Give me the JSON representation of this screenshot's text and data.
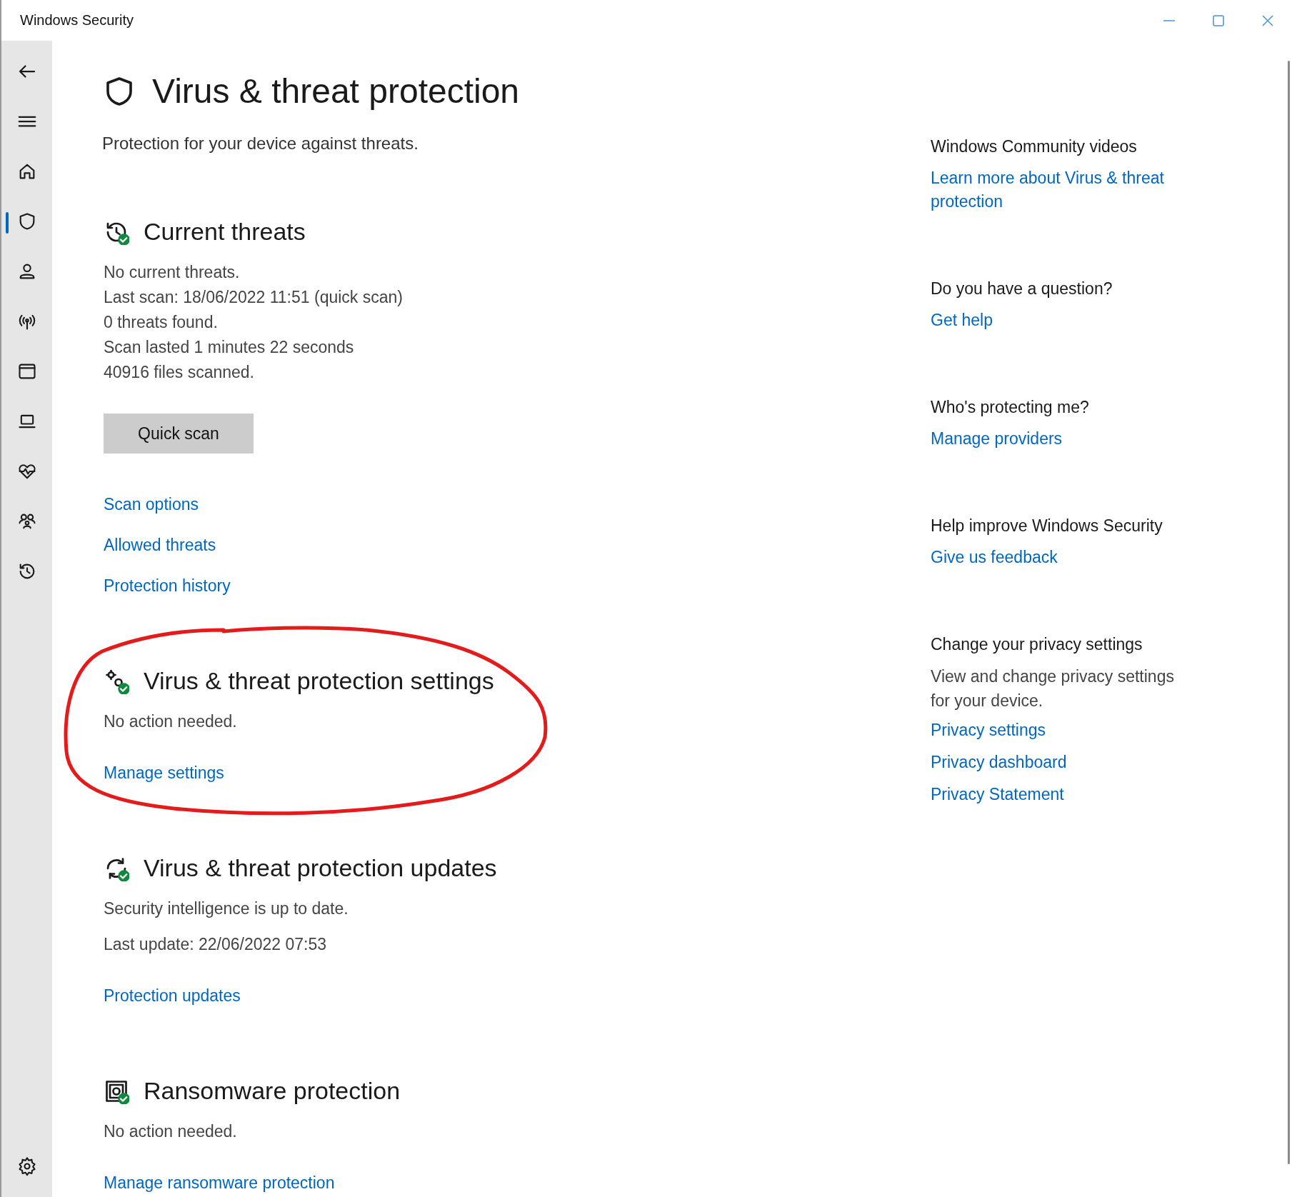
{
  "window": {
    "title": "Windows Security"
  },
  "sidebar": {
    "items": [
      {
        "selected": false
      },
      {
        "selected": true
      },
      {
        "selected": false
      },
      {
        "selected": false
      },
      {
        "selected": false
      },
      {
        "selected": false
      },
      {
        "selected": false
      },
      {
        "selected": false
      },
      {
        "selected": false
      }
    ]
  },
  "page": {
    "title": "Virus & threat protection",
    "subtitle": "Protection for your device against threats."
  },
  "sections": [
    {
      "heading": "Current threats",
      "lines": [
        "No current threats.",
        "Last scan: 18/06/2022 11:51 (quick scan)",
        "0 threats found.",
        "Scan lasted 1 minutes 22 seconds",
        "40916 files scanned."
      ],
      "button": "Quick scan",
      "links": [
        "Scan options",
        "Allowed threats",
        "Protection history"
      ]
    },
    {
      "heading": "Virus & threat protection settings",
      "lines": [
        "No action needed."
      ],
      "links": [
        "Manage settings"
      ],
      "annotated": true
    },
    {
      "heading": "Virus & threat protection updates",
      "lines": [
        "Security intelligence is up to date.",
        "Last update: 22/06/2022 07:53"
      ],
      "links": [
        "Protection updates"
      ]
    },
    {
      "heading": "Ransomware protection",
      "lines": [
        "No action needed."
      ],
      "links": [
        "Manage ransomware protection"
      ]
    }
  ],
  "aside": [
    {
      "heading": "Windows Community videos",
      "links": [
        "Learn more about Virus & threat protection"
      ]
    },
    {
      "heading": "Do you have a question?",
      "links": [
        "Get help"
      ]
    },
    {
      "heading": "Who's protecting me?",
      "links": [
        "Manage providers"
      ]
    },
    {
      "heading": "Help improve Windows Security",
      "links": [
        "Give us feedback"
      ]
    },
    {
      "heading": "Change your privacy settings",
      "text": "View and change privacy settings for your  device.",
      "links": [
        "Privacy settings",
        "Privacy dashboard",
        "Privacy Statement"
      ]
    }
  ]
}
